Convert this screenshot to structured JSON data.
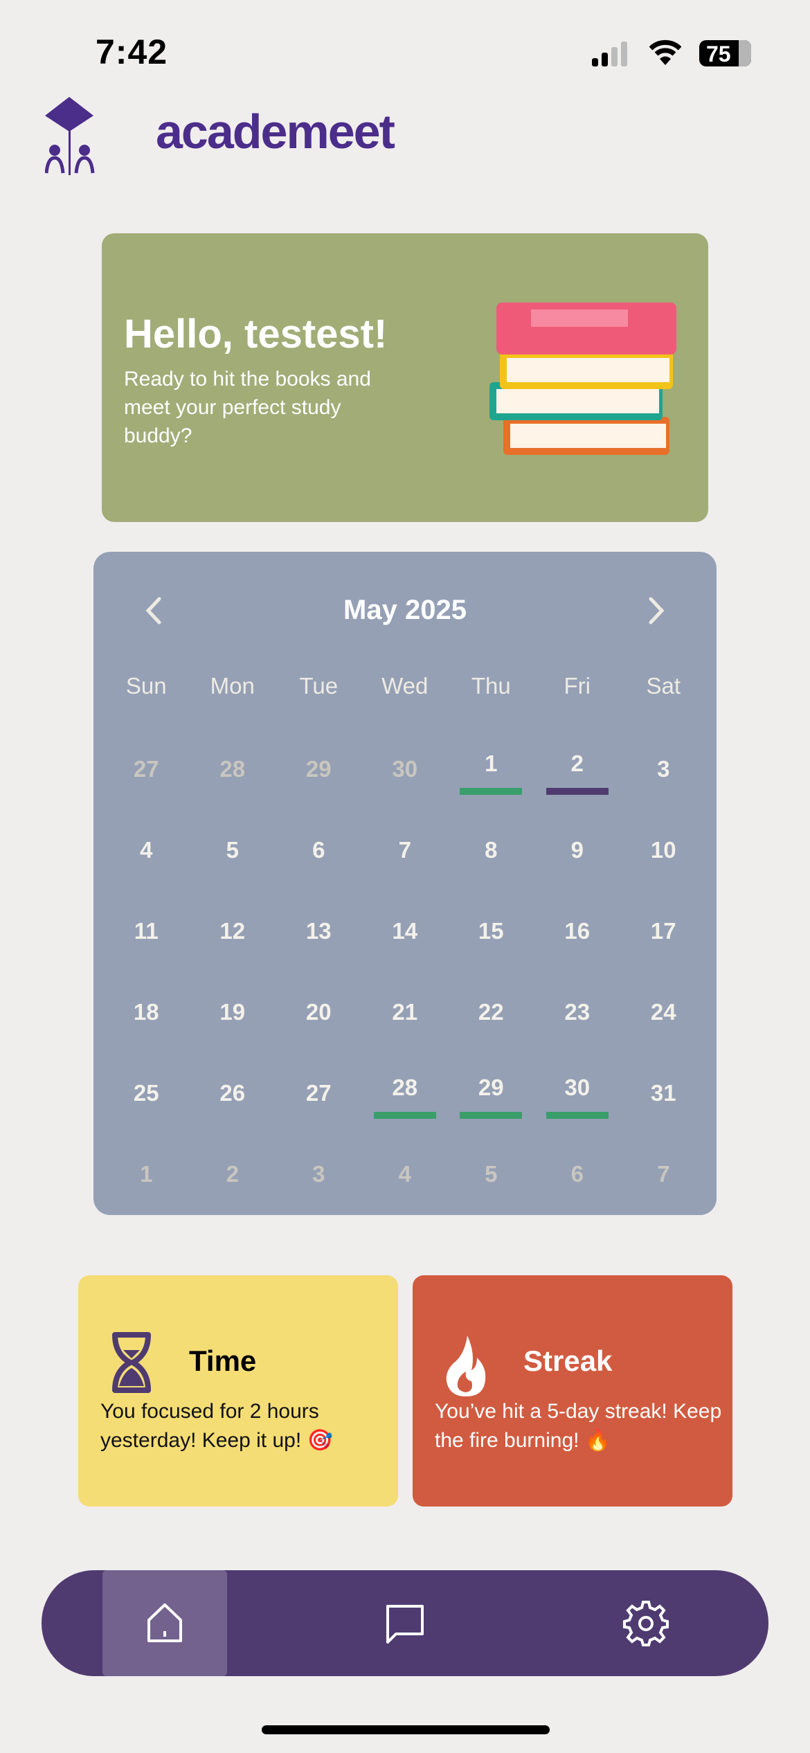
{
  "status": {
    "time": "7:42",
    "battery": "75"
  },
  "brand": {
    "name": "academeet"
  },
  "hello": {
    "title": "Hello, testest!",
    "subtitle": "Ready to hit the books and meet your perfect study buddy?"
  },
  "calendar": {
    "month_label": "May 2025",
    "weekdays": [
      "Sun",
      "Mon",
      "Tue",
      "Wed",
      "Thu",
      "Fri",
      "Sat"
    ],
    "weeks": [
      [
        {
          "d": "27",
          "m": true
        },
        {
          "d": "28",
          "m": true
        },
        {
          "d": "29",
          "m": true
        },
        {
          "d": "30",
          "m": true
        },
        {
          "d": "1",
          "mark": "#3a9e6b"
        },
        {
          "d": "2",
          "mark": "#4f3b70"
        },
        {
          "d": "3"
        }
      ],
      [
        {
          "d": "4"
        },
        {
          "d": "5"
        },
        {
          "d": "6"
        },
        {
          "d": "7"
        },
        {
          "d": "8"
        },
        {
          "d": "9"
        },
        {
          "d": "10"
        }
      ],
      [
        {
          "d": "11"
        },
        {
          "d": "12"
        },
        {
          "d": "13"
        },
        {
          "d": "14"
        },
        {
          "d": "15"
        },
        {
          "d": "16"
        },
        {
          "d": "17"
        }
      ],
      [
        {
          "d": "18"
        },
        {
          "d": "19"
        },
        {
          "d": "20"
        },
        {
          "d": "21"
        },
        {
          "d": "22"
        },
        {
          "d": "23"
        },
        {
          "d": "24"
        }
      ],
      [
        {
          "d": "25"
        },
        {
          "d": "26"
        },
        {
          "d": "27"
        },
        {
          "d": "28",
          "mark": "#3a9e6b"
        },
        {
          "d": "29",
          "mark": "#3a9e6b"
        },
        {
          "d": "30",
          "mark": "#3a9e6b"
        },
        {
          "d": "31"
        }
      ],
      [
        {
          "d": "1",
          "m": true
        },
        {
          "d": "2",
          "m": true
        },
        {
          "d": "3",
          "m": true
        },
        {
          "d": "4",
          "m": true
        },
        {
          "d": "5",
          "m": true
        },
        {
          "d": "6",
          "m": true
        },
        {
          "d": "7",
          "m": true
        }
      ]
    ]
  },
  "time_card": {
    "title": "Time",
    "text": "You focused for 2 hours yesterday! Keep it up! 🎯",
    "icon": "hourglass-icon"
  },
  "streak_card": {
    "title": "Streak",
    "text": "You’ve hit a 5-day streak! Keep the fire burning! 🔥",
    "icon": "flame-icon"
  },
  "nav": {
    "items": [
      "home",
      "chat",
      "settings"
    ],
    "active": "home"
  }
}
